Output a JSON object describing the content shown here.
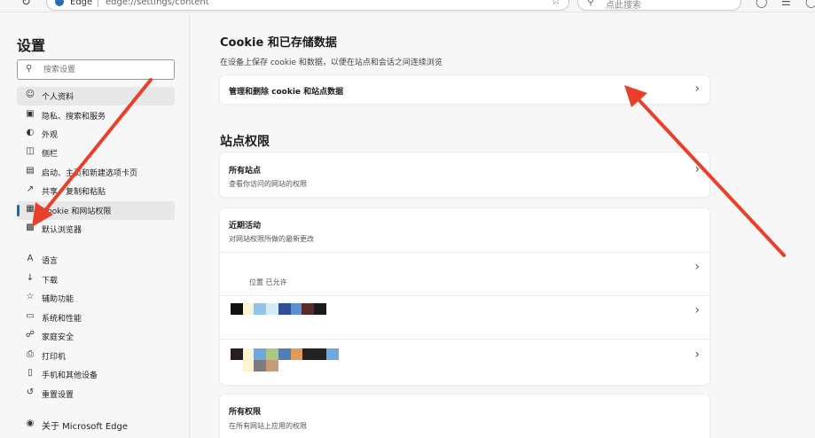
{
  "browser": {
    "tab_name": "Edge",
    "url": "edge://settings/content",
    "search_placeholder": "点此搜索"
  },
  "sidebar": {
    "title": "设置",
    "search_placeholder": "搜索设置",
    "items": [
      {
        "label": "个人资料",
        "icon": "profile-icon"
      },
      {
        "label": "隐私、搜索和服务",
        "icon": "lock-icon"
      },
      {
        "label": "外观",
        "icon": "appearance-icon"
      },
      {
        "label": "侧栏",
        "icon": "sidebar-icon"
      },
      {
        "label": "启动、主页和新建选项卡页",
        "icon": "home-icon"
      },
      {
        "label": "共享、复制和粘贴",
        "icon": "share-icon"
      },
      {
        "label": "Cookie 和网站权限",
        "icon": "cookie-icon"
      },
      {
        "label": "默认浏览器",
        "icon": "browser-icon"
      },
      {
        "label": "语言",
        "icon": "language-icon"
      },
      {
        "label": "下载",
        "icon": "download-icon"
      },
      {
        "label": "辅助功能",
        "icon": "accessibility-icon"
      },
      {
        "label": "系统和性能",
        "icon": "system-icon"
      },
      {
        "label": "家庭安全",
        "icon": "family-icon"
      },
      {
        "label": "打印机",
        "icon": "printer-icon"
      },
      {
        "label": "手机和其他设备",
        "icon": "phone-icon"
      },
      {
        "label": "重置设置",
        "icon": "reset-icon"
      }
    ],
    "about": "关于 Microsoft Edge"
  },
  "main": {
    "cookie_heading": "Cookie 和已存储数据",
    "cookie_desc": "在设备上保存 cookie 和数据，以便在站点和会话之间连续浏览",
    "manage_cookies": "管理和删除 cookie 和站点数据",
    "site_permissions_heading": "站点权限",
    "all_sites_title": "所有站点",
    "all_sites_desc": "查看你访问的网站的权限",
    "recent_title": "近期活动",
    "recent_desc": "对网站权限所做的最新更改",
    "recent_entry_tag": "位置 已允许",
    "all_permissions_title": "所有权限",
    "all_permissions_desc": "在所有网站上应用的权限"
  },
  "colors": {
    "accent": "#0f6cbd",
    "arrow": "#e8402c"
  }
}
